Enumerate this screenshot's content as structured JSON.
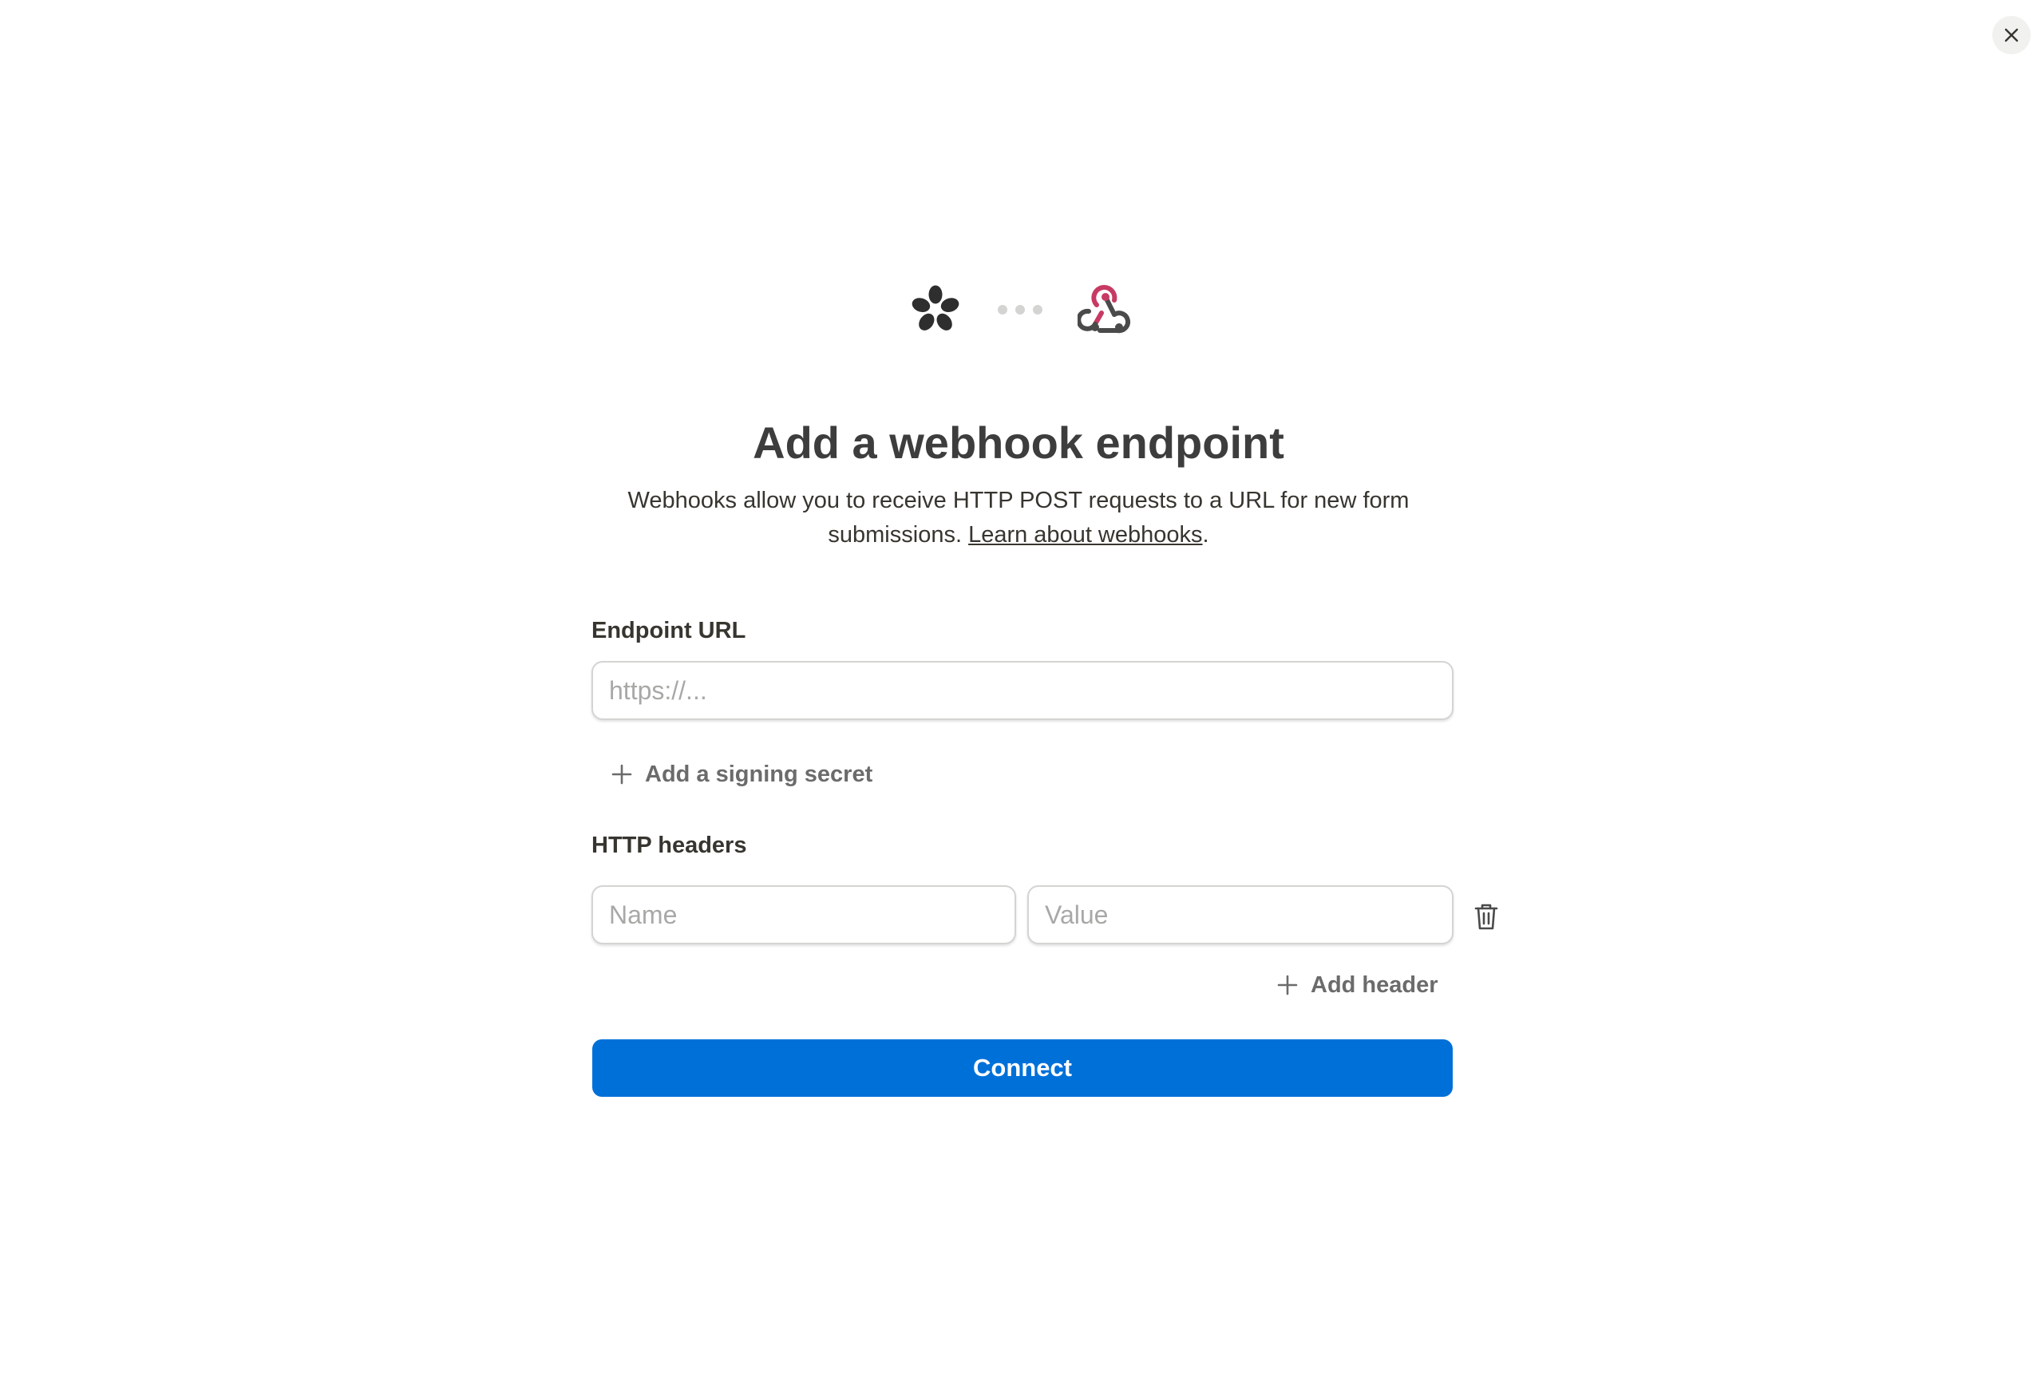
{
  "dialog": {
    "close_icon": "close-icon",
    "title": "Add a webhook endpoint",
    "description": "Webhooks allow you to receive HTTP POST requests to a URL for new form submissions.",
    "learn_link": "Learn about webhooks",
    "learn_suffix": "."
  },
  "integration": {
    "source_icon": "tally-logo-icon",
    "target_icon": "webhook-icon",
    "target_color": "#c73a63"
  },
  "form": {
    "endpoint_label": "Endpoint URL",
    "endpoint_placeholder": "https://...",
    "endpoint_value": "",
    "signing_secret_label": "Add a signing secret",
    "headers_label": "HTTP headers",
    "header_name_placeholder": "Name",
    "header_value_placeholder": "Value",
    "add_header_label": "Add header",
    "connect_label": "Connect"
  },
  "colors": {
    "primary": "#0070d9",
    "text": "#37352f",
    "muted": "#6b6b6b"
  }
}
